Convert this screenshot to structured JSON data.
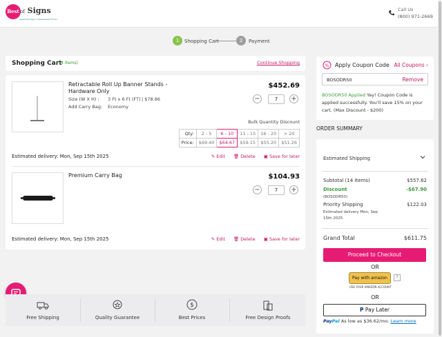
{
  "header": {
    "logo": "Best of Signs",
    "logo_tagline": "Awesome Signs. Unbelievable Prices.",
    "call_label": "Call Us",
    "call_number": "(800) 971-2669"
  },
  "steps": [
    {
      "num": "1",
      "label": "Shopping Cart",
      "active": true
    },
    {
      "num": "2",
      "label": "Payment",
      "active": false
    }
  ],
  "cart": {
    "title": "Shopping Cart",
    "count": "(14 Items)",
    "continue": "Continue Shopping",
    "items": [
      {
        "name": "Retractable Roll Up Banner Stands - Hardware Only",
        "price": "$452.69",
        "qty": "7",
        "spec1_label": "Size (W X H) :",
        "spec1_value": "3 Ft x 6 Ft (FT)",
        "spec1_extra": "|  $78.86",
        "spec2_label": "Add Carry Bag:",
        "spec2_value": "Economy",
        "bulk_title": "Bulk Quantity Discount",
        "bulk_qty_label": "Qty:",
        "bulk_price_label": "Price:",
        "bulk_qty": [
          "2 - 5",
          "6 - 10",
          "11 - 15",
          "16 - 20",
          "> 20"
        ],
        "bulk_price": [
          "$69.40",
          "$64.67",
          "$59.15",
          "$55.20",
          "$51.26"
        ],
        "estimated": "Estimated delivery: Mon, Sep 15th 2025",
        "edit": "Edit",
        "delete": "Delete",
        "save": "Save for later"
      },
      {
        "name": "Premium Carry Bag",
        "price": "$104.93",
        "qty": "7",
        "estimated": "Estimated delivery: Mon, Sep 15th 2025",
        "edit": "Edit",
        "delete": "Delete",
        "save": "Save for later"
      }
    ]
  },
  "features": [
    "Free Shipping",
    "Quality Guarantee",
    "Best Prices",
    "Free Design Proofs"
  ],
  "coupon": {
    "title": "Apply Coupon Code",
    "all": "All Coupons",
    "code": "BOSODR50",
    "remove": "Remove",
    "applied_code": "BOSODR50 Applied",
    "message": " Yay! Coupon Code is applied successfully. You'll save 15% on your cart. (Max Discount - $200)"
  },
  "summary": {
    "heading": "ORDER SUMMARY",
    "estimated_shipping": "Estimated Shipping",
    "subtotal_label": "Subtotal (14 Items)",
    "subtotal": "$557.62",
    "discount_label": "Discount",
    "discount": "-$67.90",
    "discount_code": "(BOSODR50)",
    "priority_label": "Priority Shipping",
    "priority": "$122.03",
    "priority_note": "Estimated delivery Mon, Sep 15th 2025",
    "total_label": "Grand Total",
    "total": "$611.75",
    "checkout": "Proceed to Checkout",
    "or": "OR",
    "amazon": "Pay with amazon",
    "amazon_q": "?",
    "amazon_note": "USE YOUR AMAZON ACCOUNT",
    "paylater": "Pay Later",
    "paypal_1": "Pay",
    "paypal_2": "Pal",
    "paypal_text": " As low as $36.62/mo. ",
    "paypal_learn": "Learn more"
  },
  "colors": {
    "accent": "#e61c74",
    "success": "#3a9a3a",
    "step_active": "#8bc34a",
    "step_inactive": "#9e9e9e"
  }
}
